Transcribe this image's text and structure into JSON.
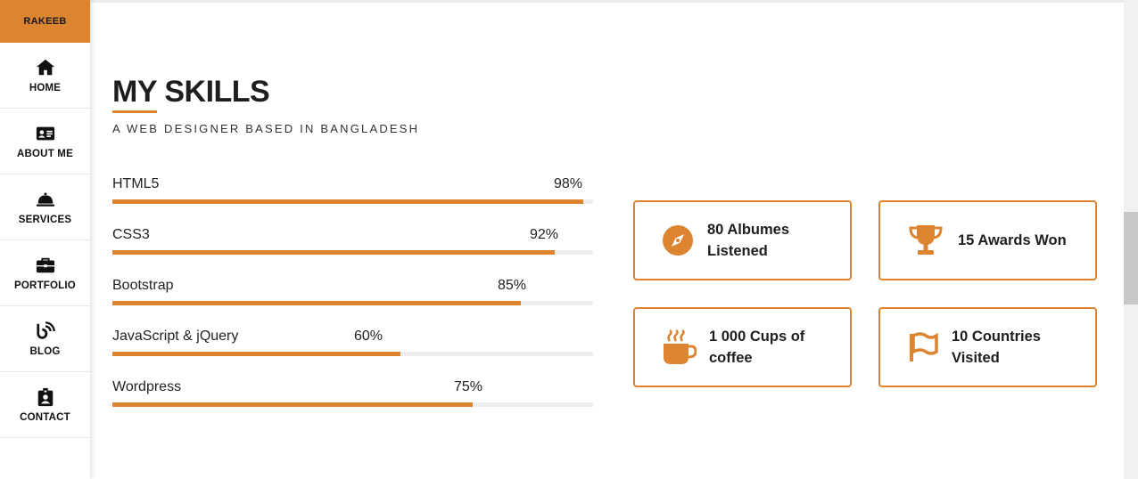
{
  "brand": "RAKEEB",
  "accent_color": "#dc8430",
  "nav": [
    {
      "label": "HOME",
      "icon": "home-icon"
    },
    {
      "label": "ABOUT ME",
      "icon": "id-card-icon"
    },
    {
      "label": "SERVICES",
      "icon": "service-bell-icon"
    },
    {
      "label": "PORTFOLIO",
      "icon": "briefcase-icon"
    },
    {
      "label": "BLOG",
      "icon": "blog-icon"
    },
    {
      "label": "CONTACT",
      "icon": "contact-badge-icon"
    }
  ],
  "section": {
    "title": "MY SKILLS",
    "subtitle": "A WEB DESIGNER BASED IN BANGLADESH"
  },
  "skills": [
    {
      "name": "HTML5",
      "percent_label": "98%",
      "percent": 98
    },
    {
      "name": "CSS3",
      "percent_label": "92%",
      "percent": 92
    },
    {
      "name": "Bootstrap",
      "percent_label": "85%",
      "percent": 85
    },
    {
      "name": "JavaScript & jQuery",
      "percent_label": "60%",
      "percent": 60
    },
    {
      "name": "Wordpress",
      "percent_label": "75%",
      "percent": 75
    }
  ],
  "stats": [
    {
      "line1": "80 Albumes",
      "line2": "Listened",
      "icon": "compass-icon"
    },
    {
      "line1": "15 Awards Won",
      "line2": "",
      "icon": "trophy-icon"
    },
    {
      "line1": "1 000 Cups of",
      "line2": "coffee",
      "icon": "coffee-cup-icon"
    },
    {
      "line1": "10 Countries",
      "line2": "Visited",
      "icon": "flag-icon"
    }
  ]
}
